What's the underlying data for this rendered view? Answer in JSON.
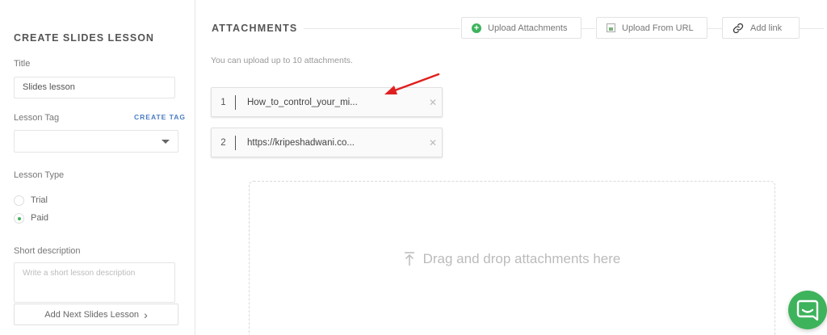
{
  "sidebar": {
    "title": "CREATE SLIDES LESSON",
    "title_label": "Title",
    "title_value": "Slides lesson",
    "tag_label": "Lesson Tag",
    "create_tag": "CREATE TAG",
    "tag_value": "",
    "type_label": "Lesson Type",
    "types": [
      {
        "label": "Trial",
        "selected": false
      },
      {
        "label": "Paid",
        "selected": true
      }
    ],
    "desc_label": "Short description",
    "desc_placeholder": "Write a short lesson description",
    "next_button": "Add Next Slides Lesson"
  },
  "main": {
    "title": "ATTACHMENTS",
    "buttons": {
      "upload": "Upload Attachments",
      "upload_url": "Upload From URL",
      "add_link": "Add link"
    },
    "hint": "You can upload up to 10 attachments.",
    "attachments": [
      {
        "index": "1",
        "name": "How_to_control_your_mi..."
      },
      {
        "index": "2",
        "name": "https://kripeshadwani.co..."
      }
    ],
    "dropzone_text": "Drag and drop attachments here"
  },
  "colors": {
    "accent_green": "#3db35c",
    "link_blue": "#4a7cc4",
    "annotation_red": "#e02020"
  }
}
